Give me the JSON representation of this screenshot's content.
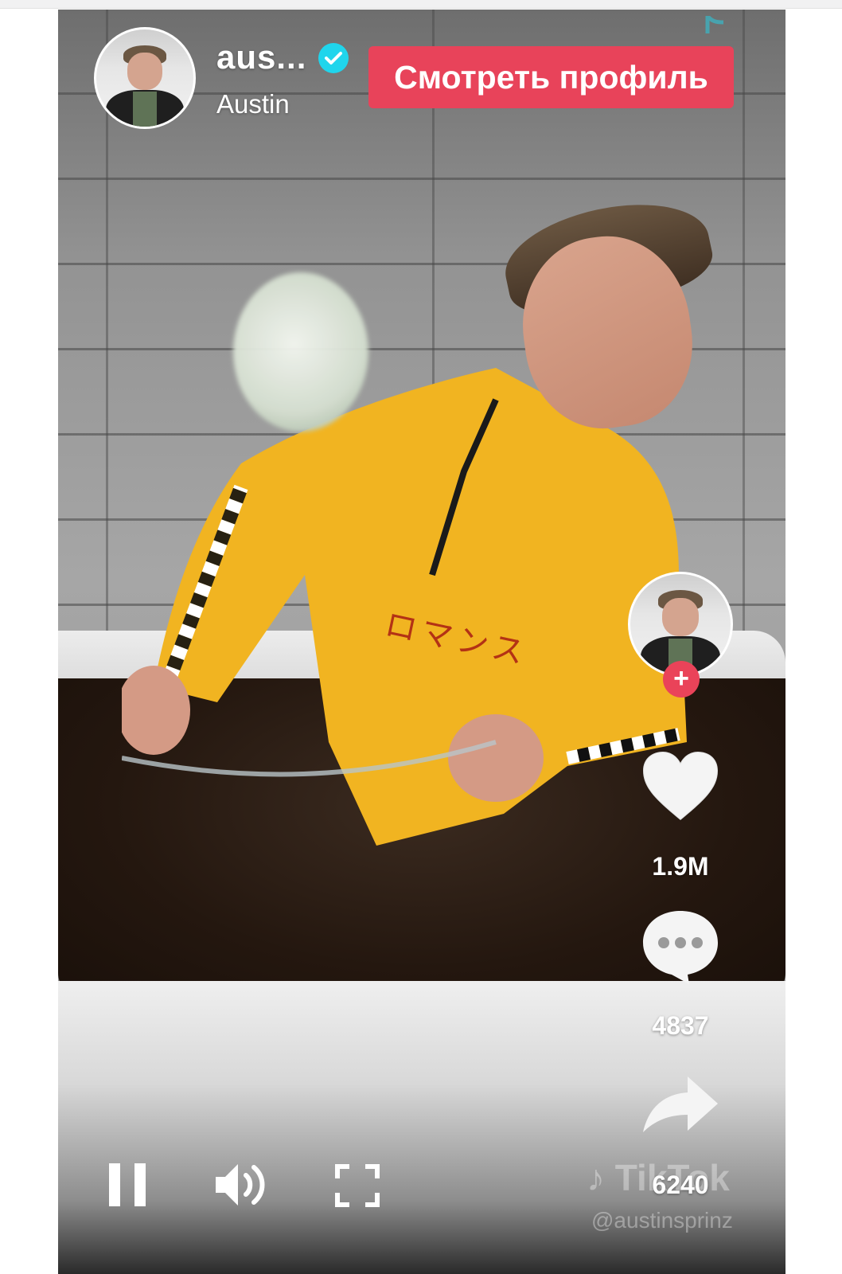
{
  "video": {
    "username": "aus...",
    "display_name": "Austin",
    "view_profile_label": "Смотреть профиль",
    "jacket_text": "ロマンス"
  },
  "actions": {
    "likes": "1.9M",
    "comments": "4837",
    "shares": "6240",
    "follow_symbol": "+"
  },
  "watermark": {
    "logo": "TikTok",
    "handle": "@austinsprinz"
  },
  "colors": {
    "accent": "#e8435a",
    "verified": "#20d5ec"
  },
  "icons": [
    "verified-icon",
    "heart-icon",
    "comment-icon",
    "share-icon",
    "pause-icon",
    "volume-icon",
    "fullscreen-icon",
    "tiktok-logo-icon"
  ]
}
